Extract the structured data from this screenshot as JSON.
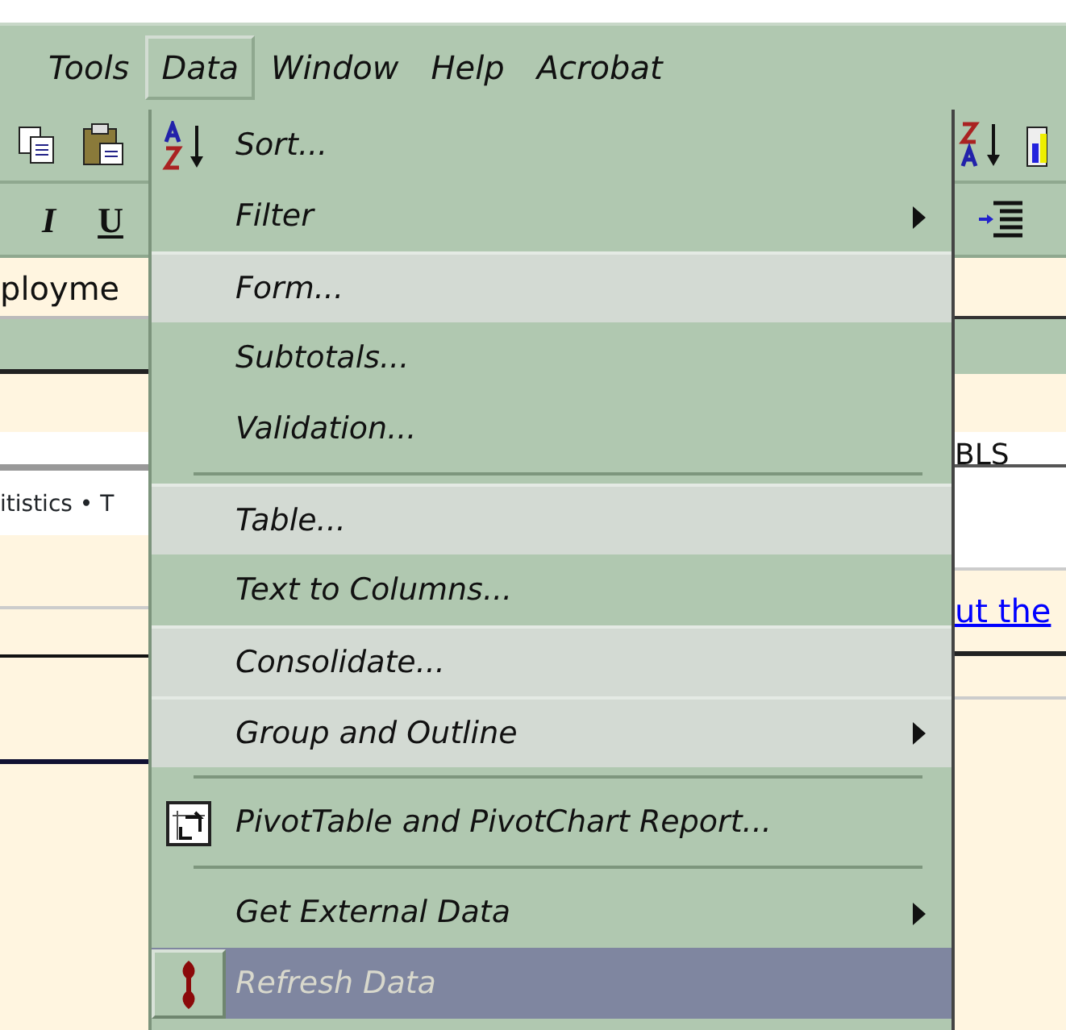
{
  "menu_bar": [
    {
      "label": "Tools",
      "selected": false
    },
    {
      "label": "Data",
      "selected": true
    },
    {
      "label": "Window",
      "selected": false
    },
    {
      "label": "Help",
      "selected": false
    },
    {
      "label": "Acrobat",
      "selected": false
    }
  ],
  "left_area": {
    "format_buttons": [
      "I",
      "U"
    ],
    "cell_text": "ployme",
    "sheet_text": "itistics • T"
  },
  "right_area": {
    "cell_text": "BLS",
    "link": "ut the"
  },
  "data_menu": [
    {
      "kind": "item",
      "label": "Sort...",
      "submenu": false,
      "expanded": false,
      "selected": false,
      "disabled": false
    },
    {
      "kind": "item",
      "label": "Filter",
      "submenu": true,
      "expanded": false,
      "selected": false,
      "disabled": false
    },
    {
      "kind": "item",
      "label": "Form...",
      "submenu": false,
      "expanded": true,
      "selected": false,
      "disabled": false
    },
    {
      "kind": "item",
      "label": "Subtotals...",
      "submenu": false,
      "expanded": false,
      "selected": false,
      "disabled": false
    },
    {
      "kind": "item",
      "label": "Validation...",
      "submenu": false,
      "expanded": false,
      "selected": false,
      "disabled": false
    },
    {
      "kind": "separator"
    },
    {
      "kind": "item",
      "label": "Table...",
      "submenu": false,
      "expanded": true,
      "selected": false,
      "disabled": false
    },
    {
      "kind": "item",
      "label": "Text to Columns...",
      "submenu": false,
      "expanded": false,
      "selected": false,
      "disabled": false
    },
    {
      "kind": "item",
      "label": "Consolidate...",
      "submenu": false,
      "expanded": true,
      "selected": false,
      "disabled": false
    },
    {
      "kind": "item",
      "label": "Group and Outline",
      "submenu": true,
      "expanded": true,
      "selected": false,
      "disabled": false
    },
    {
      "kind": "separator"
    },
    {
      "kind": "item",
      "label": "PivotTable and PivotChart Report...",
      "submenu": false,
      "expanded": false,
      "selected": false,
      "disabled": false
    },
    {
      "kind": "separator"
    },
    {
      "kind": "item",
      "label": "Get External Data",
      "submenu": true,
      "expanded": false,
      "selected": false,
      "disabled": false
    },
    {
      "kind": "item",
      "label": "Refresh Data",
      "submenu": false,
      "expanded": false,
      "selected": true,
      "disabled": true
    }
  ]
}
